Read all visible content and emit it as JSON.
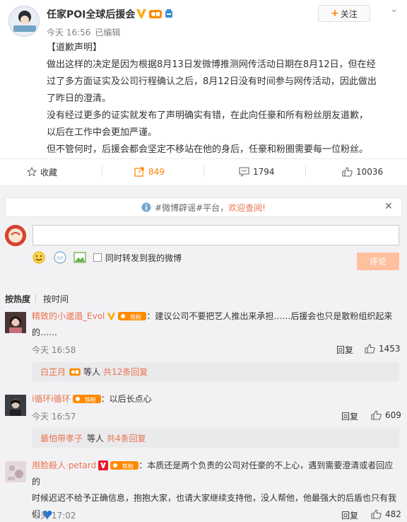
{
  "post": {
    "author": "任家POI全球后援会",
    "time": "今天 16:56",
    "edited": "已编辑",
    "follow_label": "关注",
    "avatar_text": "任家POI全球后援会",
    "paragraphs": [
      "【道歉声明】",
      "做出这样的决定是因为根据8月13日发微博推测网传活动日期在8月12日，但在经",
      "过了多方面证实及公司行程确认之后，8月12日没有时间参与网传活动，因此做出",
      "了昨日的澄清。",
      "没有经过更多的证实就发布了声明确实有错，在此向任豪和所有粉丝朋友道歉，",
      "以后在工作中会更加严谨。",
      "但不管何时，后援会都会坚定不移站在他的身后，任豪和粉圈需要每一位粉丝。"
    ]
  },
  "actions": {
    "favorite": "收藏",
    "repost": "849",
    "comment": "1794",
    "like": "10036"
  },
  "notice": {
    "prefix": "#微博辟谣#平台，",
    "link": "欢迎查阅!"
  },
  "composer": {
    "repost_label": "同时转发到我的微博",
    "submit_label": "评论"
  },
  "sort": {
    "hot": "按热度",
    "time": "按时间"
  },
  "badge_text": "铁粉",
  "reply_label": "回复",
  "comments": [
    {
      "user": "精致的小邋遢_Evol",
      "text_line1": "：建议公司不要把艺人推出来承担……后援会也只是散粉组织起来",
      "text_line2": "的……",
      "time": "今天 16:58",
      "likes": "1453",
      "sub_user": "白芷月",
      "sub_mid": "等人",
      "sub_total": "共12条回复"
    },
    {
      "user": "i循环i循环",
      "text_line1": "：以后长点心",
      "time": "今天 16:57",
      "likes": "609",
      "sub_user": "最怕带孝子",
      "sub_mid": "等人",
      "sub_total": "共4条回复"
    },
    {
      "user": "用脸殺人·petard",
      "text_line1": "：本质还是两个负责的公司对任豪的不上心，遇到需要澄清或者回应的",
      "text_line2": "时候迟迟不给予正确信息，抱抱大家，也请大家继续支持他，没人帮他，他最强大的后盾也只有我",
      "text_line3": "们",
      "time": "今天 17:02",
      "likes": "482"
    }
  ],
  "colors": {
    "accent": "#eb7350",
    "orange": "#ff8200",
    "comment_bg": "#f2f2f5",
    "submit_disabled": "#ffc09f"
  }
}
